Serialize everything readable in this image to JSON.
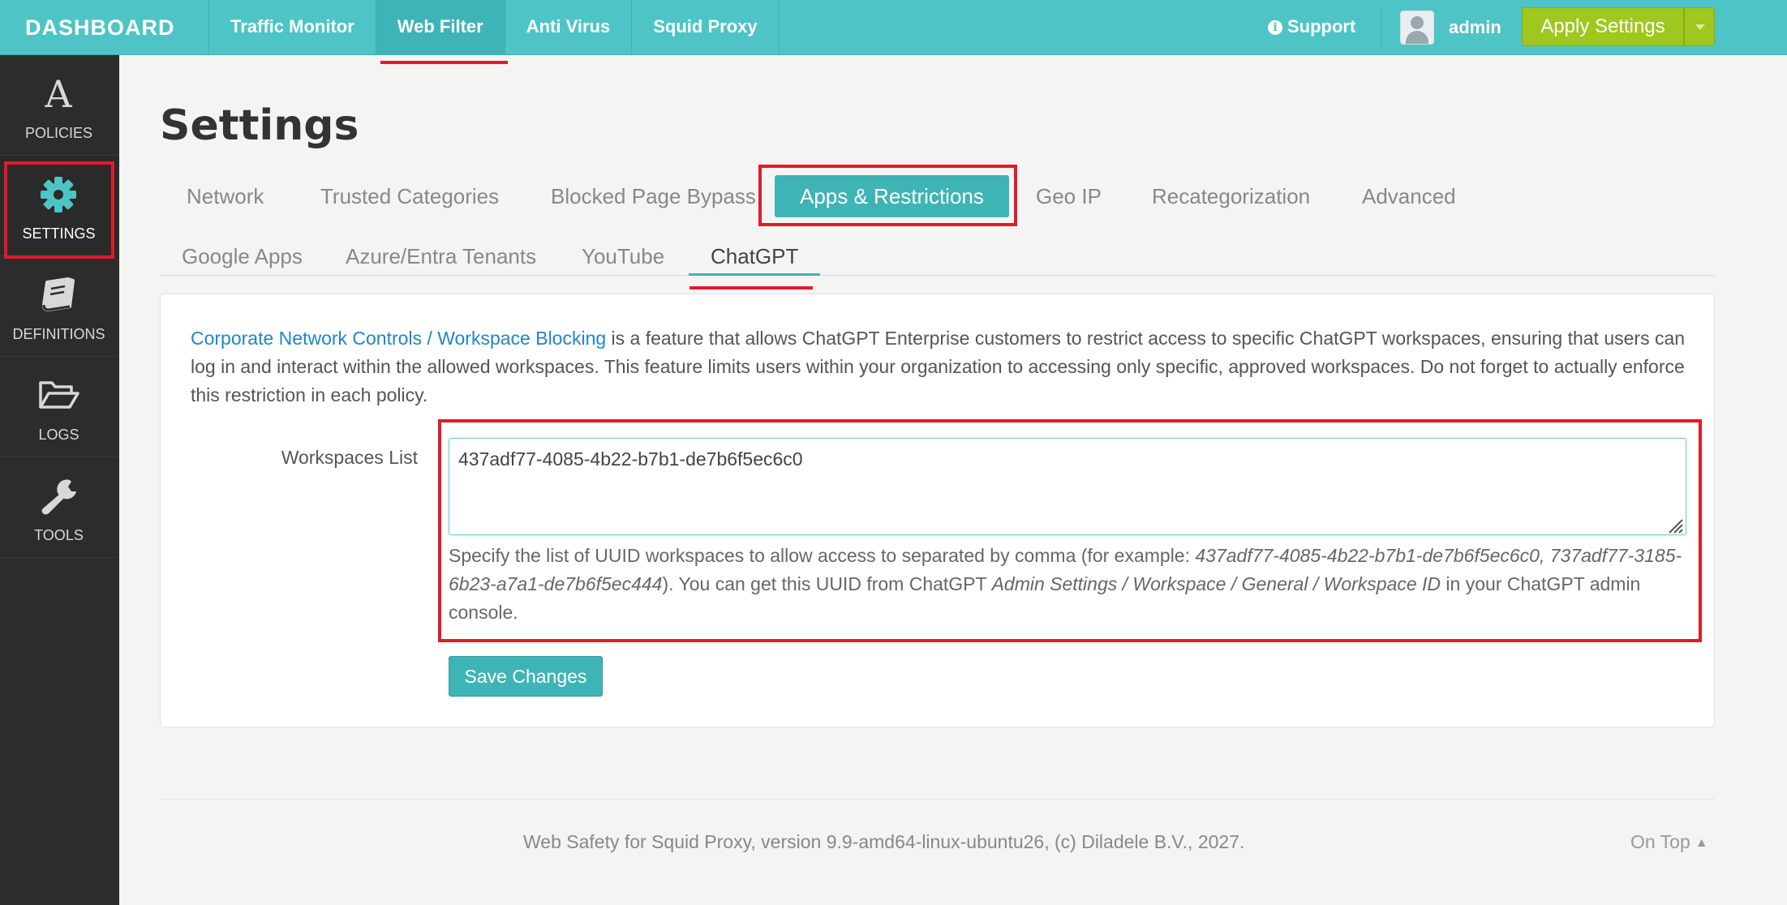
{
  "brand": "DASHBOARD",
  "topnav": [
    {
      "label": "Traffic Monitor",
      "active": false
    },
    {
      "label": "Web Filter",
      "active": true
    },
    {
      "label": "Anti Virus",
      "active": false
    },
    {
      "label": "Squid Proxy",
      "active": false
    }
  ],
  "header": {
    "support_label": "Support",
    "user_name": "admin",
    "apply_label": "Apply Settings"
  },
  "sidebar": [
    {
      "label": "POLICIES",
      "icon": "policies-icon"
    },
    {
      "label": "SETTINGS",
      "icon": "gear-icon",
      "active": true
    },
    {
      "label": "DEFINITIONS",
      "icon": "book-icon"
    },
    {
      "label": "LOGS",
      "icon": "folder-open-icon"
    },
    {
      "label": "TOOLS",
      "icon": "wrench-icon"
    }
  ],
  "page_title": "Settings",
  "tabs_primary": [
    {
      "label": "Network"
    },
    {
      "label": "Trusted Categories"
    },
    {
      "label": "Blocked Page Bypass"
    },
    {
      "label": "Apps & Restrictions",
      "active": true
    },
    {
      "label": "Geo IP"
    },
    {
      "label": "Recategorization"
    },
    {
      "label": "Advanced"
    }
  ],
  "tabs_secondary": [
    {
      "label": "Google Apps"
    },
    {
      "label": "Azure/Entra Tenants"
    },
    {
      "label": "YouTube"
    },
    {
      "label": "ChatGPT",
      "active": true
    }
  ],
  "panel": {
    "desc_link": "Corporate Network Controls / Workspace Blocking",
    "desc_text": " is a feature that allows ChatGPT Enterprise customers to restrict access to specific ChatGPT workspaces, ensuring that users can log in and interact within the allowed workspaces. This feature limits users within your organization to accessing only specific, approved workspaces. Do not forget to actually enforce this restriction in each policy.",
    "field_label": "Workspaces List",
    "field_value": "437adf77-4085-4b22-b7b1-de7b6f5ec6c0",
    "help_1": "Specify the list of UUID workspaces to allow access to separated by comma (for example: ",
    "help_example": "437adf77-4085-4b22-b7b1-de7b6f5ec6c0, 737adf77-3185-6b23-a7a1-de7b6f5ec444",
    "help_2": "). You can get this UUID from ChatGPT ",
    "help_path": "Admin Settings / Workspace / General / Workspace ID",
    "help_3": " in your ChatGPT admin console.",
    "save_label": "Save Changes"
  },
  "footer": {
    "text": "Web Safety for Squid Proxy, version 9.9-amd64-linux-ubuntu26, (c) Diladele B.V., 2027.",
    "on_top": "On Top"
  },
  "colors": {
    "topbar": "#4ec4c6",
    "accent": "#3fb4b6",
    "apply": "#9fc71e",
    "highlight": "#e11a2d",
    "sidebar": "#2c2c2c",
    "link": "#1e86c9"
  }
}
